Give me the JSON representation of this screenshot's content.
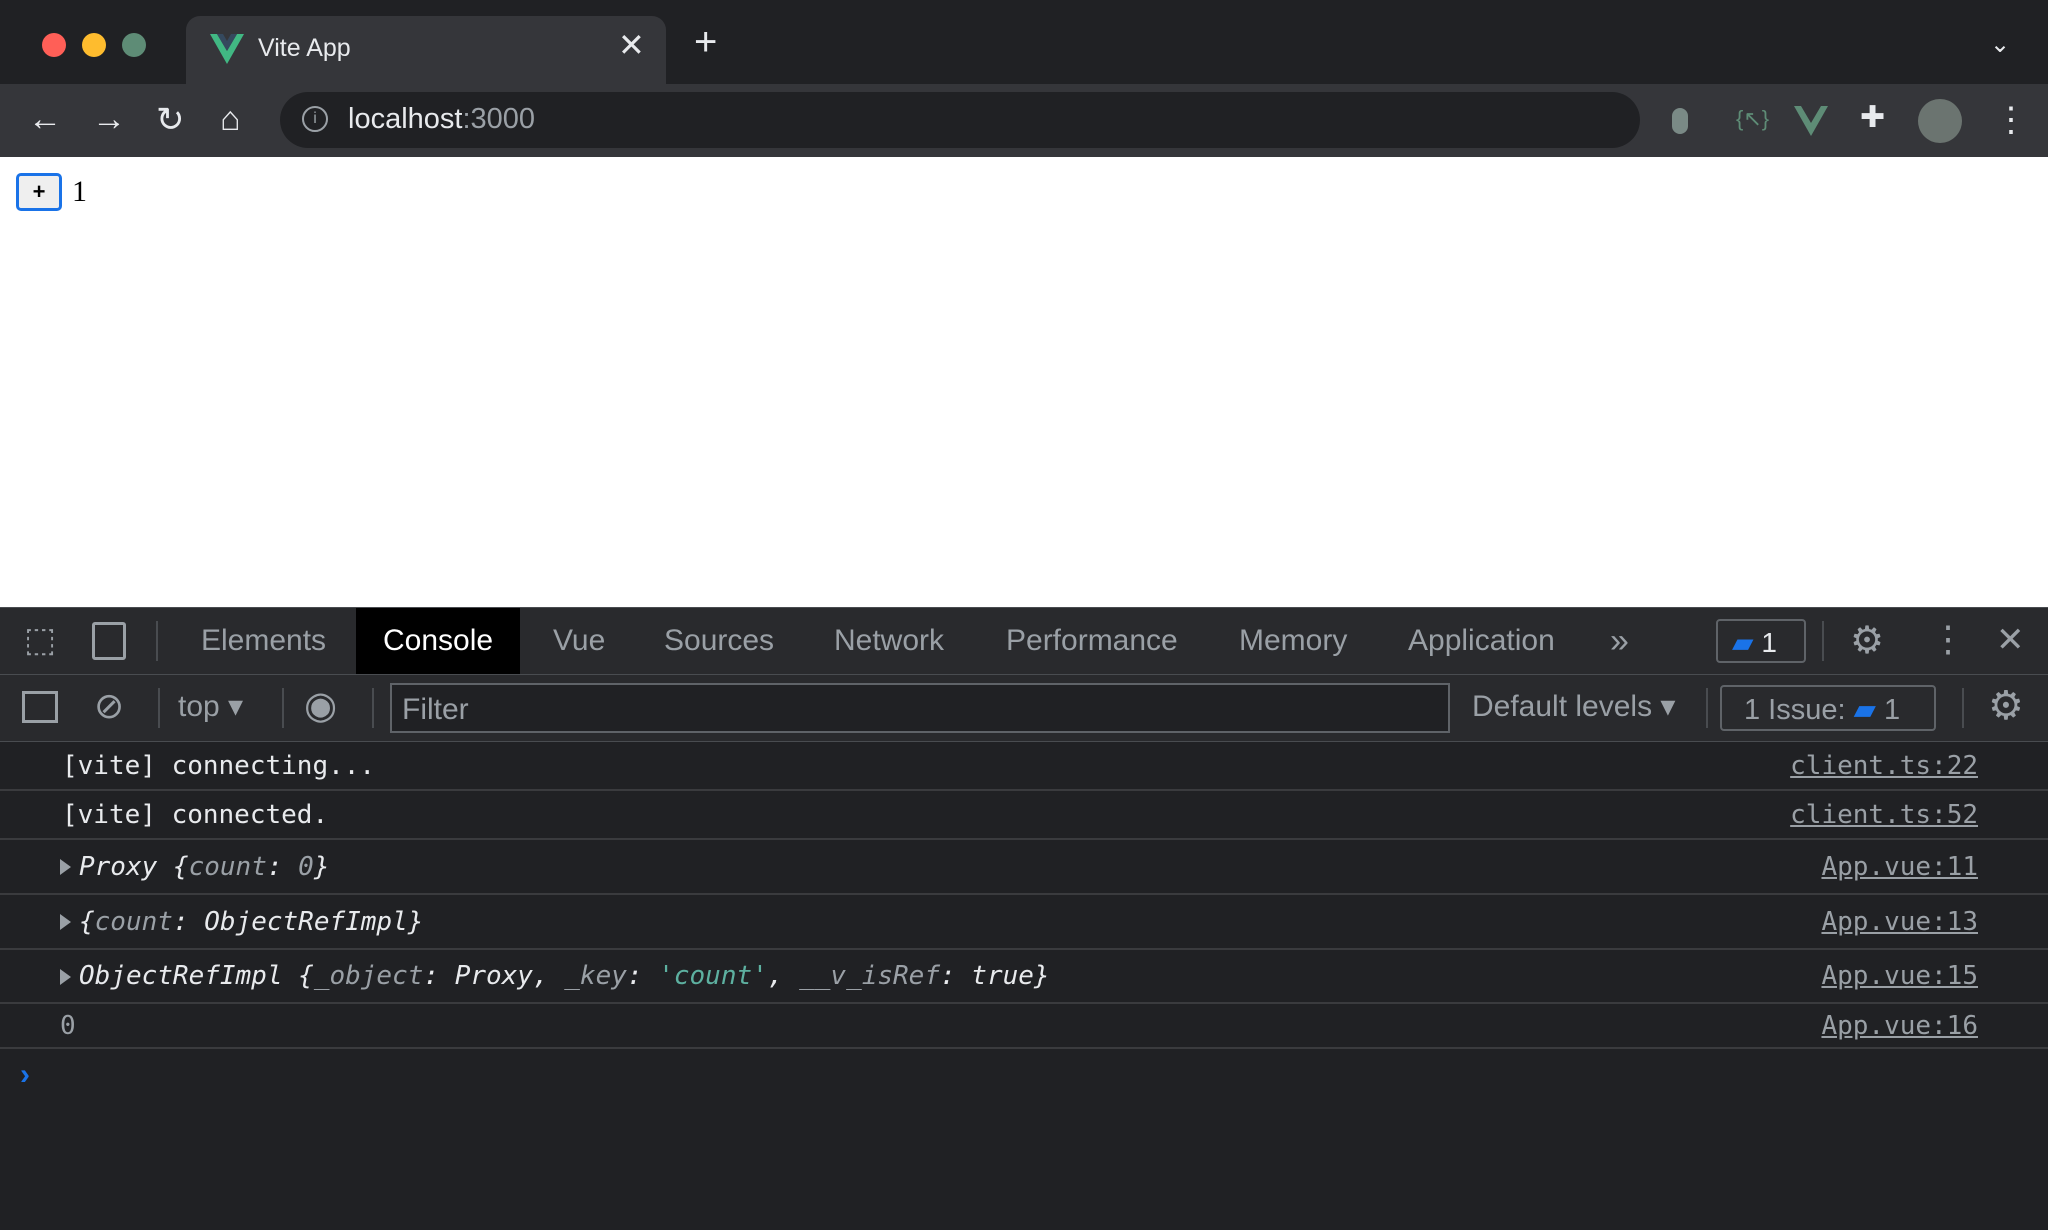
{
  "browser": {
    "tab_title": "Vite App",
    "url_host": "localhost",
    "url_port": ":3000",
    "colors": {
      "close": "#ff5f57",
      "minimize": "#febc2e",
      "zoom": "#28c840",
      "vue": "#41b883"
    }
  },
  "page": {
    "button_label": "+",
    "count": "1"
  },
  "devtools": {
    "tabs": [
      "Elements",
      "Console",
      "Vue",
      "Sources",
      "Network",
      "Performance",
      "Memory",
      "Application"
    ],
    "active_tab": "Console",
    "messages_badge": "1",
    "context": "top",
    "filter_placeholder": "Filter",
    "levels": "Default levels",
    "issues_label": "1 Issue:",
    "issues_count": "1"
  },
  "console": {
    "rows": [
      {
        "text": "[vite] connecting...",
        "source": "client.ts:22"
      },
      {
        "text": "[vite] connected.",
        "source": "client.ts:52"
      },
      {
        "source": "App.vue:11"
      },
      {
        "source": "App.vue:13"
      },
      {
        "source": "App.vue:15"
      },
      {
        "text": "0",
        "source": "App.vue:16"
      }
    ],
    "r3": {
      "a": "Proxy {",
      "k": "count",
      "c": ": ",
      "v": "0",
      "e": "}"
    },
    "r4": {
      "a": "{",
      "k": "count",
      "c": ": ObjectRefImpl}"
    },
    "r5": {
      "a": "ObjectRefImpl {",
      "k1": "_object",
      "b": ": Proxy, ",
      "k2": "_key",
      "c": ": ",
      "s": "'count'",
      "d": ", ",
      "k3": "__v_isRef",
      "e": ": true}"
    }
  }
}
